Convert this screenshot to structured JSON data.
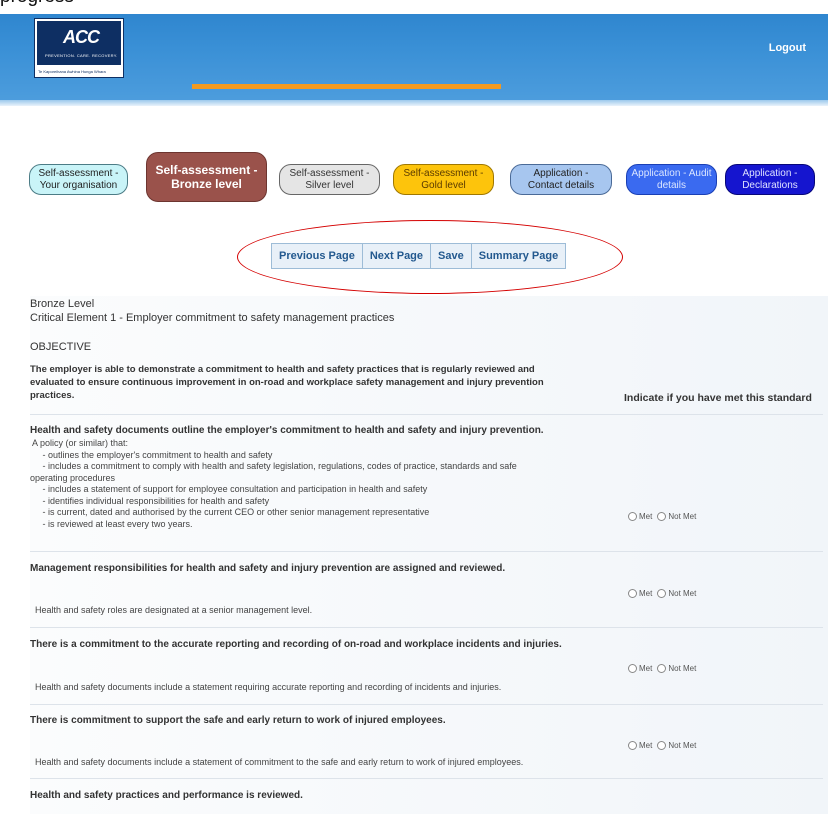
{
  "page_fragment": "progress",
  "header": {
    "logo": {
      "mark": "ACC",
      "subtitle": "PREVENTION. CARE. RECOVERY.",
      "tagline": "Te Kaporeihana Awhina Hunga Whara"
    },
    "logout_label": "Logout"
  },
  "steps": [
    {
      "label": "Self-assessment - Your organisation"
    },
    {
      "label": "Self-assessment - Bronze level"
    },
    {
      "label": "Self-assessment - Silver level"
    },
    {
      "label": "Self-assessment - Gold level"
    },
    {
      "label": "Application - Contact details"
    },
    {
      "label": "Application - Audit details"
    },
    {
      "label": "Application - Declarations"
    }
  ],
  "nav": {
    "previous": "Previous Page",
    "next": "Next Page",
    "save": "Save",
    "summary": "Summary Page"
  },
  "content": {
    "level": "Bronze Level",
    "element": "Critical Element 1 - Employer commitment to safety management practices",
    "objective_heading": "OBJECTIVE",
    "objective_text_1": "The employer is able to demonstrate a commitment to health and safety practices that is regularly reviewed and",
    "objective_text_2": "evaluated to ensure continuous improvement in on-road and workplace safety management and injury prevention",
    "objective_text_3": "practices.",
    "indicate_label": "Indicate if you have met this standard",
    "met_label": "Met",
    "not_met_label": "Not Met",
    "sections": [
      {
        "heading": "Health and safety documents outline the employer's commitment to health and safety and injury prevention.",
        "lines": [
          " A policy (or similar) that:",
          "     - outlines the employer's commitment to health and safety",
          "     - includes a commitment to comply with health and safety legislation, regulations, codes of practice, standards and safe",
          "operating procedures",
          "     - includes a statement of support for employee consultation and participation in health and safety",
          "     - identifies individual responsibilities for health and safety",
          "     - is current, dated and authorised by the current CEO or other senior management representative",
          "     - is reviewed at least every two years."
        ]
      },
      {
        "heading": "Management responsibilities for health and safety and injury prevention are assigned and reviewed.",
        "lines": [
          "Health and safety roles are designated at a senior management level."
        ]
      },
      {
        "heading": "There is a commitment to the accurate reporting and recording of on-road and workplace incidents and injuries.",
        "lines": [
          "Health and safety documents include a statement requiring accurate reporting and recording of incidents and injuries."
        ]
      },
      {
        "heading": "There is commitment to support the safe and early return to work of injured employees.",
        "lines": [
          "Health and safety documents include a statement of commitment to the safe and early return to work of injured employees."
        ]
      },
      {
        "heading": "Health and safety practices and performance is reviewed.",
        "lines": []
      }
    ]
  },
  "colors": {
    "header_blue": "#3a90d6",
    "orange_accent": "#f39a1f",
    "bronze_active": "#9a524b",
    "gold": "#fdc40c",
    "annotation_red": "#d40000"
  }
}
